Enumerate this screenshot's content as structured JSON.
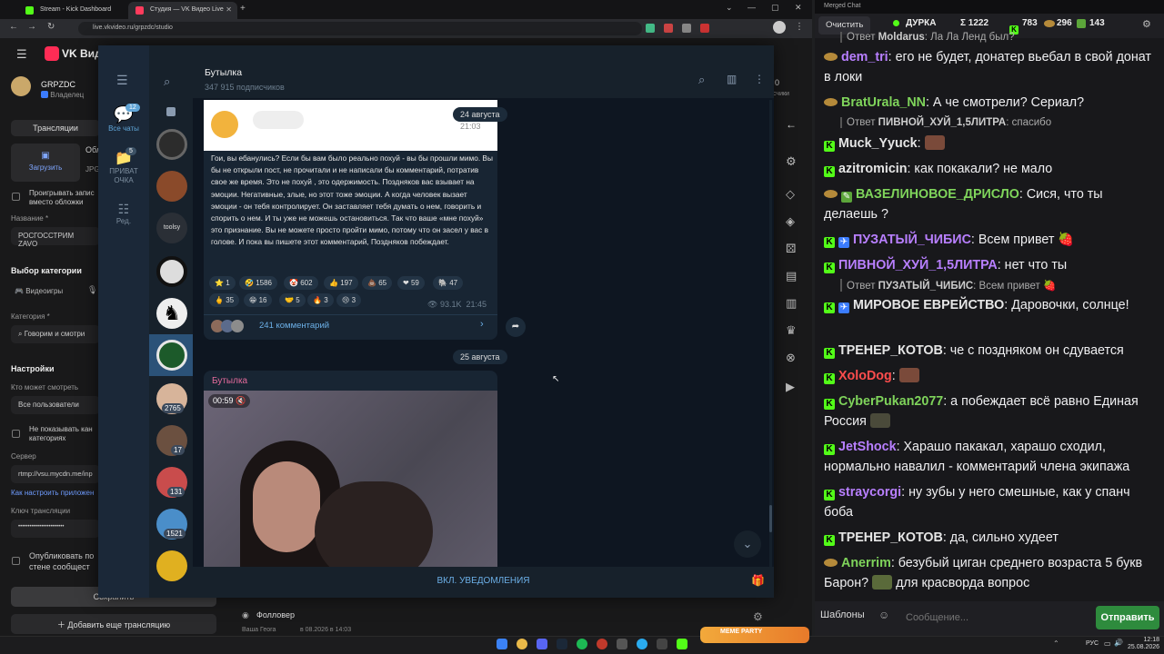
{
  "browser": {
    "tabs": [
      {
        "label": "Stream - Kick Dashboard"
      },
      {
        "label": "Студия — VK Видео Live"
      }
    ],
    "url": "live.vkvideo.ru/grpzdc/studio"
  },
  "vk": {
    "brand": "VK Видео",
    "channel": "GRPZDC",
    "role": "Владелец",
    "tab_broadcasts": "Трансляции",
    "upload": "Загрузить",
    "cover_title": "Обл",
    "cover_hint": "JPG",
    "play_record": "Проигрывать запис",
    "play_record2": "вместо обложки",
    "name_label": "Название *",
    "name_value": "РОСГОССТРИМ ZAVO",
    "category_title": "Выбор категории",
    "games": "Видеоигры",
    "category_label": "Категория *",
    "category_value": "Говорим и смотри",
    "settings": "Настройки",
    "who_can_watch": "Кто может смотреть",
    "all_users": "Все пользователи",
    "hide_channel": "Не показывать кан",
    "hide_channel2": "категориях",
    "server": "Сервер",
    "server_value": "rtmp://vsu.mycdn.me/inp",
    "how_setup": "Как настроить приложен",
    "key_label": "Ключ трансляции",
    "key_value": "••••••••••••••••••••••••",
    "publish": "Опубликовать по",
    "publish2": "стене сообщест",
    "save": "Сохранить",
    "add_broadcast": "Добавить еще трансляцию",
    "follower": "Фолловер",
    "follower_sub": "Ваша Геога",
    "follower_date": "в 08.2026 в 14:03",
    "right_zero": "0",
    "right_subs": "счики"
  },
  "telegram": {
    "channel": "Бутылка",
    "subscribers": "347 915 подписчиков",
    "folders": [
      {
        "label": "Все чаты",
        "badge": "12"
      },
      {
        "label": "ПРИВАТ ОЧКА",
        "badge": "5"
      },
      {
        "label": "Ред."
      }
    ],
    "avatar_badges": [
      "2765",
      "17",
      "131",
      "1521"
    ],
    "avatar_text": "toolsy",
    "date1": "24 августа",
    "time1": "21:03",
    "post_text": "Гои, вы ебанулись? Если бы вам было реально похуй - вы бы прошли мимо. Вы бы не открыли пост, не прочитали и не написали бы комментарий, потратив свое же время. Это не похуй , это одержимость. Поздняков вас взывает на эмоции. Негативные, злые, но этот тоже эмоции. А когда человек вызает эмоции - он тебя контролирует. Он заставляет тебя думать о нем, говорить и спорить о нем. И ты уже не можешь остановиться. Так что ваше «мне похуй» это признание. Вы не можете просто пройти мимо, потому что он засел у вас в голове. И пока вы пишете этот комментарий, Поздняков побеждает.",
    "reactions": [
      {
        "e": "⭐",
        "n": "1"
      },
      {
        "e": "🤣",
        "n": "1586"
      },
      {
        "e": "🤡",
        "n": "602"
      },
      {
        "e": "👍",
        "n": "197"
      },
      {
        "e": "💩",
        "n": "65"
      },
      {
        "e": "❤",
        "n": "59"
      },
      {
        "e": "🐘",
        "n": "47"
      },
      {
        "e": "🖕",
        "n": "35"
      },
      {
        "e": "😁",
        "n": "16"
      },
      {
        "e": "🤝",
        "n": "5"
      },
      {
        "e": "🔥",
        "n": "3"
      },
      {
        "e": "😢",
        "n": "3"
      }
    ],
    "views": "93.1K",
    "time2": "21:45",
    "comments": "241 комментарий",
    "date2": "25 августа",
    "post2_author": "Бутылка",
    "video_time": "00:59",
    "notify": "ВКЛ. УВЕДОМЛЕНИЯ"
  },
  "chat": {
    "window_title": "Merged Chat",
    "clear": "Очистить",
    "streamer": "ДУРКА",
    "total": "Σ 1222",
    "kick_count": "783",
    "twitch_count": "296",
    "other_count": "143",
    "placeholder": "Сообщение...",
    "templates": "Шаблоны",
    "send": "Отправить",
    "messages": [
      {
        "type": "reply",
        "prefix": "Ответ ",
        "to": "Moldarus",
        "text": ": Ла Ла Ленд был?"
      },
      {
        "src": "tw",
        "nick": "dem_tri",
        "color": "#b87fff",
        "text": ": его не будет, донатер вьебал в свой донат в локи"
      },
      {
        "src": "tw",
        "nick": "BratUrala_NN",
        "color": "#7fd45b",
        "text": ": А че смотрели? Сериал?"
      },
      {
        "type": "reply",
        "prefix": "Ответ ",
        "to": "ПИВНОЙ_ХУЙ_1,5ЛИТРА",
        "text": ": спасибо"
      },
      {
        "src": "kick",
        "nick": "Muck_Yyuck",
        "color": "#e6e6e6",
        "text": ":"
      },
      {
        "src": "kick",
        "nick": "azitromicin",
        "color": "#e6e6e6",
        "text": ": как покакали? не мало"
      },
      {
        "src": "tw",
        "nick": "ВАЗЕЛИНОВОЕ_ДРИСЛО",
        "color": "#7fd45b",
        "text": ": Сися, что ты делаешь ?"
      },
      {
        "src": "kick",
        "nick": "ПУЗАТЫЙ_ЧИБИС",
        "color": "#b87fff",
        "text": ": Всем привет"
      },
      {
        "src": "kick",
        "nick": "ПИВНОЙ_ХУЙ_1,5ЛИТРА",
        "color": "#b87fff",
        "text": ": нет что ты"
      },
      {
        "type": "reply",
        "prefix": "Ответ ",
        "to": "ПУЗАТЫЙ_ЧИБИС",
        "text": ": Всем привет"
      },
      {
        "src": "kick",
        "nick": "МИРОВОЕ ЕВРЕЙСТВО",
        "color": "#e6e6e6",
        "text": ": Даровочки, солнце!"
      },
      {
        "src": "kick",
        "nick": "ТРЕНЕР_КОТОВ",
        "color": "#e6e6e6",
        "text": ": че с поздняком он сдувается"
      },
      {
        "src": "kick",
        "nick": "XoloDog",
        "color": "#ff4d4d",
        "text": ":"
      },
      {
        "src": "kick",
        "nick": "CyberPukan2077",
        "color": "#7fd45b",
        "text": ": а побеждает всё равно Единая Россия"
      },
      {
        "src": "kick",
        "nick": "JetShock",
        "color": "#b87fff",
        "text": ": Харашо пакакал, харашо сходил, нормально навалил - комментарий члена экипажа"
      },
      {
        "src": "kick",
        "nick": "straycorgi",
        "color": "#b87fff",
        "text": ": ну зубы у него смешные, как у спанч боба"
      },
      {
        "src": "kick",
        "nick": "ТРЕНЕР_КОТОВ",
        "color": "#e6e6e6",
        "text": ": да, сильно худеет"
      },
      {
        "src": "tw",
        "nick": "Anerrim",
        "color": "#7fd45b",
        "text": ": безубый циган среднего возраста 5 букв Барон?"
      },
      {
        "extra": "для красворда вопрос"
      }
    ]
  },
  "taskbar": {
    "lang": "РУС",
    "time": "12:18",
    "date": "25.08.2026",
    "meme_label": "MEME PARTY"
  }
}
